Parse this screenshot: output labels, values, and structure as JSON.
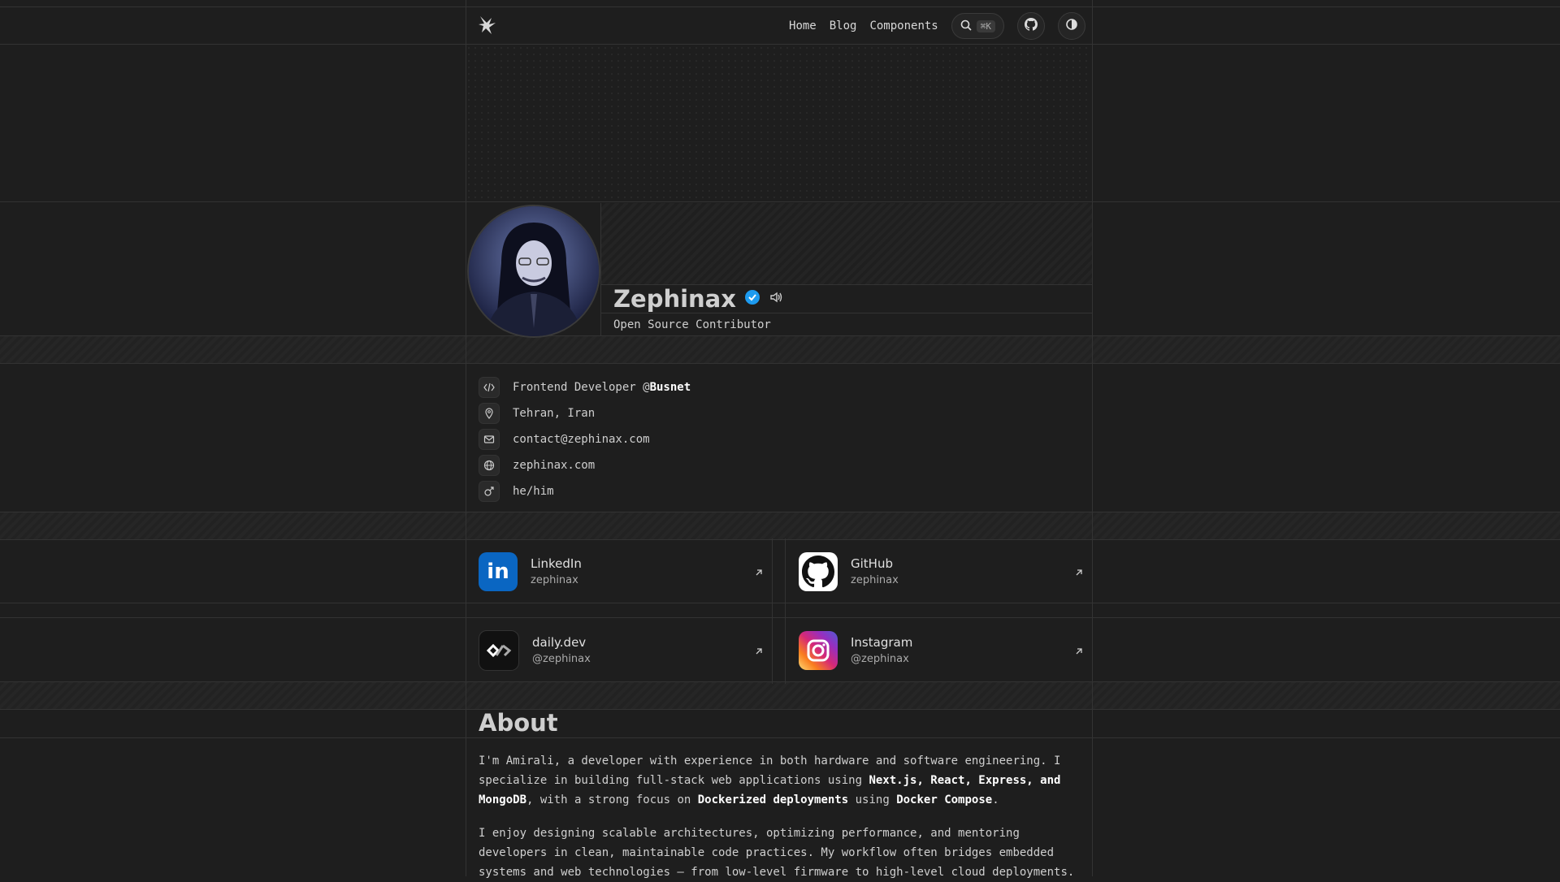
{
  "nav": {
    "home": "Home",
    "blog": "Blog",
    "components": "Components",
    "search_shortcut": "⌘K"
  },
  "profile": {
    "name": "Zephinax",
    "subtitle": "Open Source Contributor"
  },
  "info": [
    {
      "icon": "code-icon",
      "text_prefix": "Frontend Developer @",
      "text_bold": "Busnet"
    },
    {
      "icon": "map-pin-icon",
      "text": "Tehran, Iran"
    },
    {
      "icon": "mail-icon",
      "text": "contact@zephinax.com"
    },
    {
      "icon": "globe-icon",
      "text": "zephinax.com"
    },
    {
      "icon": "male-icon",
      "text": "he/him"
    }
  ],
  "social": [
    {
      "name": "LinkedIn",
      "handle": "zephinax",
      "color": "#0a66c2"
    },
    {
      "name": "GitHub",
      "handle": "zephinax",
      "color": "#ffffff"
    },
    {
      "name": "daily.dev",
      "handle": "@zephinax",
      "color": "#111111"
    },
    {
      "name": "Instagram",
      "handle": "@zephinax",
      "color": "#e1306c"
    }
  ],
  "about": {
    "title": "About",
    "p1": {
      "a": "I'm Amirali, a developer with experience in both hardware and software engineering. I specialize in building full-stack web applications using ",
      "b1": "Next.js, React, Express, and MongoDB",
      "c": ", with a strong focus on ",
      "b2": "Dockerized deployments",
      "d": " using ",
      "b3": "Docker Compose",
      "e": "."
    },
    "p2": "I enjoy designing scalable architectures, optimizing performance, and mentoring developers in clean, maintainable code practices. My workflow often bridges embedded systems and web technologies — from low-level firmware to high-level cloud deployments."
  }
}
